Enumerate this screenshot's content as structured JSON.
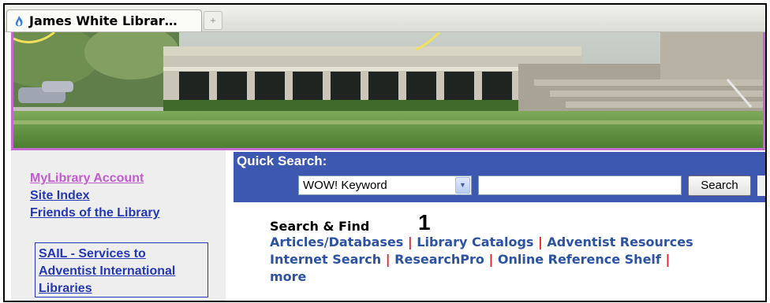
{
  "tab": {
    "title": "James White Librar…",
    "new_tab_glyph": "+"
  },
  "left_links": {
    "mylibrary": "MyLibrary Account",
    "site_index": "Site Index",
    "friends": "Friends of the Library",
    "sail_line1": "SAIL - Services to",
    "sail_line2": "Adventist International",
    "sail_line3": "Libraries"
  },
  "quick_search": {
    "title": "Quick Search:",
    "selected_option": "WOW! Keyword",
    "input_value": "",
    "button_label": "Search"
  },
  "search_find": {
    "heading": "Search & Find",
    "marker": "1",
    "links": [
      "Articles/Databases",
      "Library Catalogs",
      "Adventist Resources",
      "Internet Search",
      "ResearchPro",
      "Online Reference Shelf",
      "more"
    ],
    "separator": "|"
  },
  "colors": {
    "visited_link": "#c35bd0",
    "link": "#2437b5",
    "quick_search_bar": "#3d58b0",
    "search_find_link": "#2c52a3",
    "separator": "#e41e1e",
    "banner_border": "#c46bd0"
  }
}
